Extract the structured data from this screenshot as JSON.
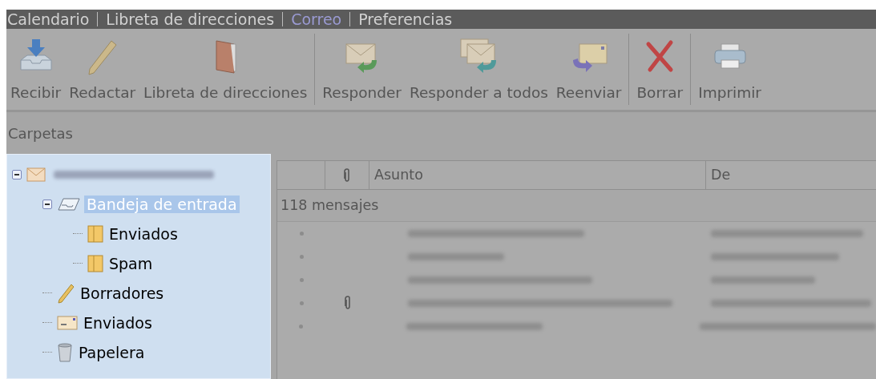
{
  "tabs": [
    {
      "label": "Calendario",
      "selected": false
    },
    {
      "label": "Libreta de direcciones",
      "selected": false
    },
    {
      "label": "Correo",
      "selected": true
    },
    {
      "label": "Preferencias",
      "selected": false
    }
  ],
  "toolbar": [
    [
      {
        "label": "Recibir",
        "kind": "receive"
      },
      {
        "label": "Redactar",
        "kind": "compose"
      },
      {
        "label": "Libreta de direcciones",
        "kind": "addressbook"
      }
    ],
    [
      {
        "label": "Responder",
        "kind": "reply"
      },
      {
        "label": "Responder a todos",
        "kind": "replyall"
      },
      {
        "label": "Reenviar",
        "kind": "forward"
      }
    ],
    [
      {
        "label": "Borrar",
        "kind": "delete"
      }
    ],
    [
      {
        "label": "Imprimir",
        "kind": "print"
      }
    ]
  ],
  "folders": {
    "title": "Carpetas",
    "tree": [
      {
        "kind": "account",
        "expanded": true,
        "selected": false,
        "children": [
          {
            "kind": "inbox",
            "label": "Bandeja de entrada",
            "expanded": true,
            "selected": true,
            "children": [
              {
                "kind": "folder",
                "label": "Enviados",
                "selected": false
              },
              {
                "kind": "folder",
                "label": "Spam",
                "selected": false
              }
            ]
          },
          {
            "kind": "drafts",
            "label": "Borradores",
            "selected": false
          },
          {
            "kind": "sent",
            "label": "Enviados",
            "selected": false
          },
          {
            "kind": "trash",
            "label": "Papelera",
            "selected": false
          }
        ]
      }
    ]
  },
  "messages": {
    "columns": [
      "Asunto",
      "De"
    ],
    "count": "118 mensajes",
    "rows": [
      {
        "attachment": false
      },
      {
        "attachment": false
      },
      {
        "attachment": false
      },
      {
        "attachment": true
      },
      {
        "attachment": false
      }
    ]
  }
}
